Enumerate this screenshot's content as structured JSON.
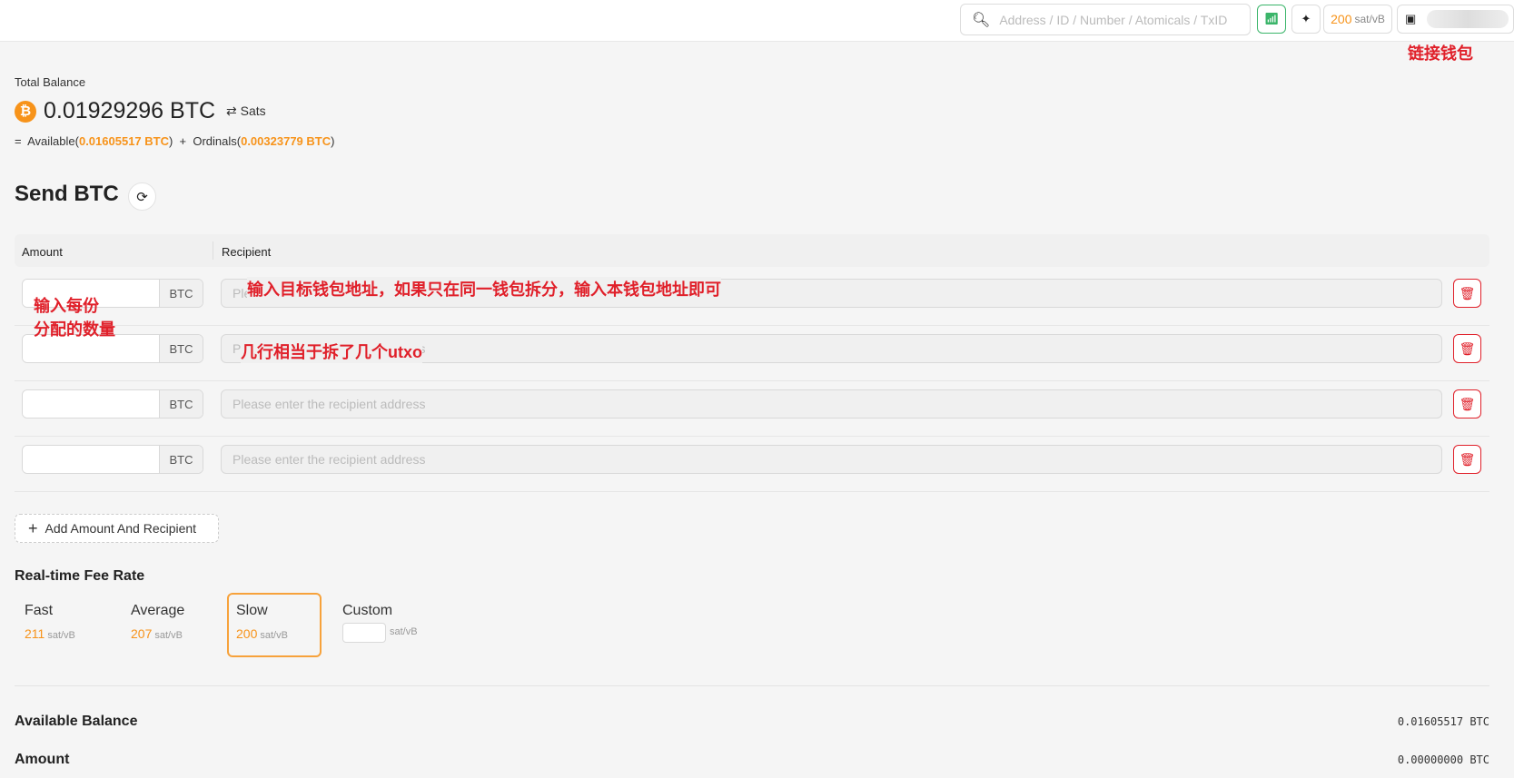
{
  "header": {
    "search_placeholder": "Address / ID / Number / Atomicals / TxID",
    "fee_value": "200",
    "fee_unit": "sat/vB",
    "connect_annotation": "链接钱包"
  },
  "balance": {
    "label": "Total Balance",
    "total": "0.01929296 BTC",
    "toggle": "Sats",
    "eq": "=",
    "available_label": "Available(",
    "available": "0.01605517 BTC",
    "plus": ")  +  Ordinals(",
    "ordinals": "0.00323779 BTC",
    "close": ")"
  },
  "send": {
    "title": "Send BTC",
    "col_amount": "Amount",
    "col_recipient": "Recipient",
    "unit": "BTC",
    "recipient_placeholder": "Please enter the recipient address",
    "add_label": "Add Amount And Recipient"
  },
  "annotations": {
    "amount": "输入每份\n分配的数量",
    "recipient": "输入目标钱包地址，如果只在同一钱包拆分，输入本钱包地址即可",
    "rows": "几行相当于拆了几个utxo"
  },
  "fee_rate": {
    "title": "Real-time Fee Rate",
    "unit": "sat/vB",
    "options": [
      {
        "name": "Fast",
        "value": "211"
      },
      {
        "name": "Average",
        "value": "207"
      },
      {
        "name": "Slow",
        "value": "200",
        "selected": true
      },
      {
        "name": "Custom"
      }
    ]
  },
  "summary": {
    "available_label": "Available Balance",
    "available_value": "0.01605517 BTC",
    "amount_label": "Amount",
    "amount_value": "0.00000000 BTC"
  },
  "colors": {
    "accent": "#f7931a",
    "danger": "#e0202a",
    "success": "#3bb56a"
  }
}
